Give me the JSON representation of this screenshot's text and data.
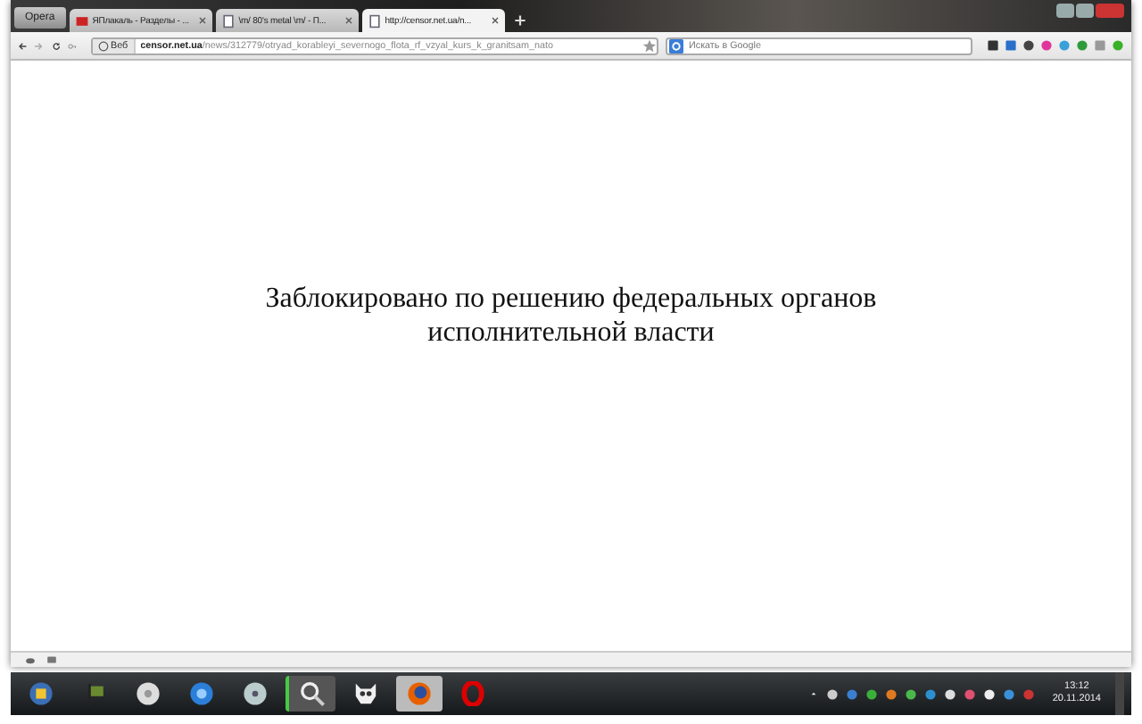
{
  "browser": {
    "menu_button": "Opera",
    "tabs": [
      {
        "label": "ЯПлакаль - Разделы - ...",
        "selected": false
      },
      {
        "label": "\\m/ 80's metal \\m/ - П...",
        "selected": false
      },
      {
        "label": "http://censor.net.ua/n...",
        "selected": true
      }
    ],
    "address_bar": {
      "badge": "Веб",
      "url": "**censor.net.ua**/news/312779/otryad_korableyi_severnogo_flota_rf_vzyal_kurs_k_granitsam_nato"
    },
    "search": {
      "placeholder": "Искать в Google"
    }
  },
  "page": {
    "message": "Заблокировано по решению федеральных органов исполнительной власти"
  },
  "taskbar": {
    "time": "13:12",
    "date": "20.11.2014"
  }
}
